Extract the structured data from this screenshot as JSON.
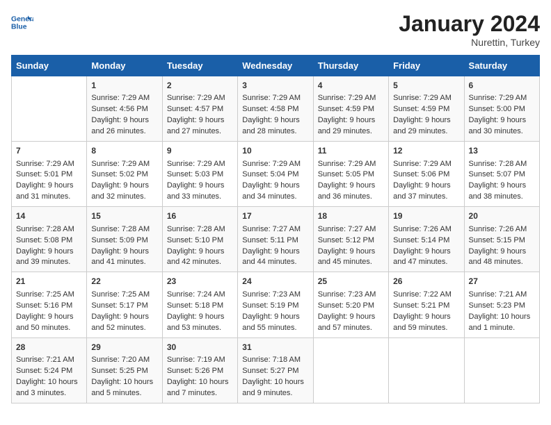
{
  "header": {
    "logo_line1": "General",
    "logo_line2": "Blue",
    "month_title": "January 2024",
    "location": "Nurettin, Turkey"
  },
  "calendar": {
    "days_of_week": [
      "Sunday",
      "Monday",
      "Tuesday",
      "Wednesday",
      "Thursday",
      "Friday",
      "Saturday"
    ],
    "weeks": [
      [
        {
          "day": "",
          "sunrise": "",
          "sunset": "",
          "daylight": ""
        },
        {
          "day": "1",
          "sunrise": "Sunrise: 7:29 AM",
          "sunset": "Sunset: 4:56 PM",
          "daylight": "Daylight: 9 hours and 26 minutes."
        },
        {
          "day": "2",
          "sunrise": "Sunrise: 7:29 AM",
          "sunset": "Sunset: 4:57 PM",
          "daylight": "Daylight: 9 hours and 27 minutes."
        },
        {
          "day": "3",
          "sunrise": "Sunrise: 7:29 AM",
          "sunset": "Sunset: 4:58 PM",
          "daylight": "Daylight: 9 hours and 28 minutes."
        },
        {
          "day": "4",
          "sunrise": "Sunrise: 7:29 AM",
          "sunset": "Sunset: 4:59 PM",
          "daylight": "Daylight: 9 hours and 29 minutes."
        },
        {
          "day": "5",
          "sunrise": "Sunrise: 7:29 AM",
          "sunset": "Sunset: 4:59 PM",
          "daylight": "Daylight: 9 hours and 29 minutes."
        },
        {
          "day": "6",
          "sunrise": "Sunrise: 7:29 AM",
          "sunset": "Sunset: 5:00 PM",
          "daylight": "Daylight: 9 hours and 30 minutes."
        }
      ],
      [
        {
          "day": "7",
          "sunrise": "Sunrise: 7:29 AM",
          "sunset": "Sunset: 5:01 PM",
          "daylight": "Daylight: 9 hours and 31 minutes."
        },
        {
          "day": "8",
          "sunrise": "Sunrise: 7:29 AM",
          "sunset": "Sunset: 5:02 PM",
          "daylight": "Daylight: 9 hours and 32 minutes."
        },
        {
          "day": "9",
          "sunrise": "Sunrise: 7:29 AM",
          "sunset": "Sunset: 5:03 PM",
          "daylight": "Daylight: 9 hours and 33 minutes."
        },
        {
          "day": "10",
          "sunrise": "Sunrise: 7:29 AM",
          "sunset": "Sunset: 5:04 PM",
          "daylight": "Daylight: 9 hours and 34 minutes."
        },
        {
          "day": "11",
          "sunrise": "Sunrise: 7:29 AM",
          "sunset": "Sunset: 5:05 PM",
          "daylight": "Daylight: 9 hours and 36 minutes."
        },
        {
          "day": "12",
          "sunrise": "Sunrise: 7:29 AM",
          "sunset": "Sunset: 5:06 PM",
          "daylight": "Daylight: 9 hours and 37 minutes."
        },
        {
          "day": "13",
          "sunrise": "Sunrise: 7:28 AM",
          "sunset": "Sunset: 5:07 PM",
          "daylight": "Daylight: 9 hours and 38 minutes."
        }
      ],
      [
        {
          "day": "14",
          "sunrise": "Sunrise: 7:28 AM",
          "sunset": "Sunset: 5:08 PM",
          "daylight": "Daylight: 9 hours and 39 minutes."
        },
        {
          "day": "15",
          "sunrise": "Sunrise: 7:28 AM",
          "sunset": "Sunset: 5:09 PM",
          "daylight": "Daylight: 9 hours and 41 minutes."
        },
        {
          "day": "16",
          "sunrise": "Sunrise: 7:28 AM",
          "sunset": "Sunset: 5:10 PM",
          "daylight": "Daylight: 9 hours and 42 minutes."
        },
        {
          "day": "17",
          "sunrise": "Sunrise: 7:27 AM",
          "sunset": "Sunset: 5:11 PM",
          "daylight": "Daylight: 9 hours and 44 minutes."
        },
        {
          "day": "18",
          "sunrise": "Sunrise: 7:27 AM",
          "sunset": "Sunset: 5:12 PM",
          "daylight": "Daylight: 9 hours and 45 minutes."
        },
        {
          "day": "19",
          "sunrise": "Sunrise: 7:26 AM",
          "sunset": "Sunset: 5:14 PM",
          "daylight": "Daylight: 9 hours and 47 minutes."
        },
        {
          "day": "20",
          "sunrise": "Sunrise: 7:26 AM",
          "sunset": "Sunset: 5:15 PM",
          "daylight": "Daylight: 9 hours and 48 minutes."
        }
      ],
      [
        {
          "day": "21",
          "sunrise": "Sunrise: 7:25 AM",
          "sunset": "Sunset: 5:16 PM",
          "daylight": "Daylight: 9 hours and 50 minutes."
        },
        {
          "day": "22",
          "sunrise": "Sunrise: 7:25 AM",
          "sunset": "Sunset: 5:17 PM",
          "daylight": "Daylight: 9 hours and 52 minutes."
        },
        {
          "day": "23",
          "sunrise": "Sunrise: 7:24 AM",
          "sunset": "Sunset: 5:18 PM",
          "daylight": "Daylight: 9 hours and 53 minutes."
        },
        {
          "day": "24",
          "sunrise": "Sunrise: 7:23 AM",
          "sunset": "Sunset: 5:19 PM",
          "daylight": "Daylight: 9 hours and 55 minutes."
        },
        {
          "day": "25",
          "sunrise": "Sunrise: 7:23 AM",
          "sunset": "Sunset: 5:20 PM",
          "daylight": "Daylight: 9 hours and 57 minutes."
        },
        {
          "day": "26",
          "sunrise": "Sunrise: 7:22 AM",
          "sunset": "Sunset: 5:21 PM",
          "daylight": "Daylight: 9 hours and 59 minutes."
        },
        {
          "day": "27",
          "sunrise": "Sunrise: 7:21 AM",
          "sunset": "Sunset: 5:23 PM",
          "daylight": "Daylight: 10 hours and 1 minute."
        }
      ],
      [
        {
          "day": "28",
          "sunrise": "Sunrise: 7:21 AM",
          "sunset": "Sunset: 5:24 PM",
          "daylight": "Daylight: 10 hours and 3 minutes."
        },
        {
          "day": "29",
          "sunrise": "Sunrise: 7:20 AM",
          "sunset": "Sunset: 5:25 PM",
          "daylight": "Daylight: 10 hours and 5 minutes."
        },
        {
          "day": "30",
          "sunrise": "Sunrise: 7:19 AM",
          "sunset": "Sunset: 5:26 PM",
          "daylight": "Daylight: 10 hours and 7 minutes."
        },
        {
          "day": "31",
          "sunrise": "Sunrise: 7:18 AM",
          "sunset": "Sunset: 5:27 PM",
          "daylight": "Daylight: 10 hours and 9 minutes."
        },
        {
          "day": "",
          "sunrise": "",
          "sunset": "",
          "daylight": ""
        },
        {
          "day": "",
          "sunrise": "",
          "sunset": "",
          "daylight": ""
        },
        {
          "day": "",
          "sunrise": "",
          "sunset": "",
          "daylight": ""
        }
      ]
    ]
  }
}
